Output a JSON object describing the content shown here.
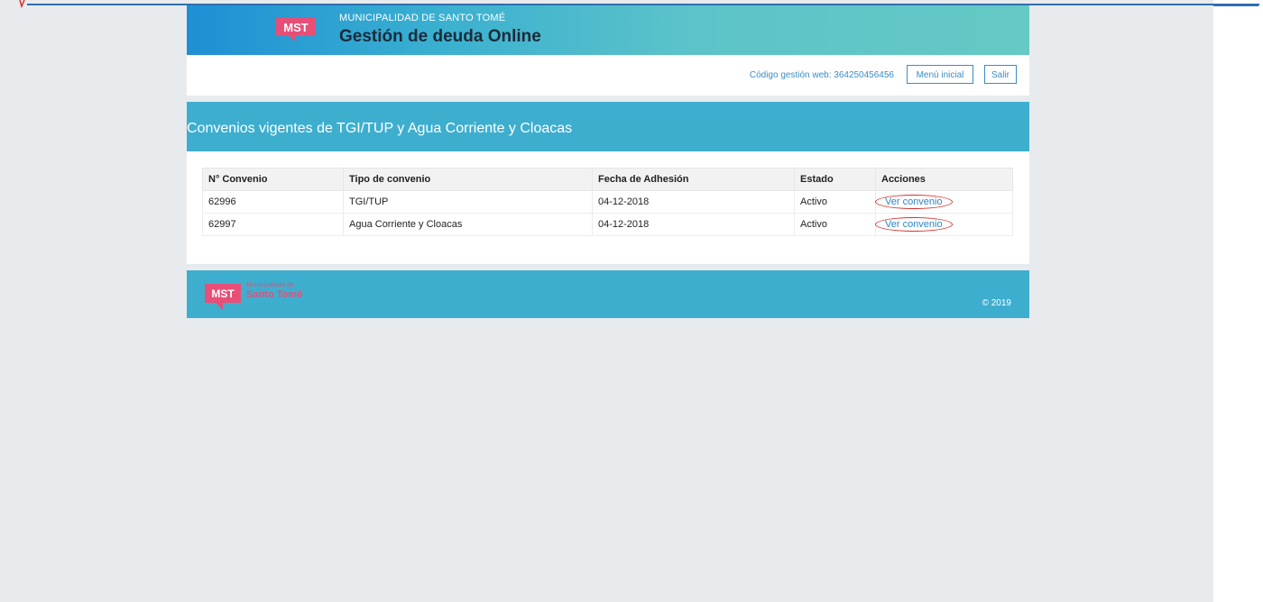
{
  "header": {
    "logo_text": "MST",
    "org_name": "MUNICIPALIDAD DE SANTO TOMÉ",
    "app_title": "Gestión de deuda Online"
  },
  "nav": {
    "code_label": "Código gestión web: 364250456456",
    "menu_button": "Menú inicial",
    "exit_button": "Salir"
  },
  "card": {
    "title": "Convenios vigentes de TGI/TUP y Agua Corriente y Cloacas"
  },
  "table": {
    "columns": [
      "N° Convenio",
      "Tipo de convenio",
      "Fecha de Adhesión",
      "Estado",
      "Acciones"
    ],
    "rows": [
      [
        "62996",
        "TGI/TUP",
        "04-12-2018",
        "Activo",
        "Ver convenio"
      ],
      [
        "62997",
        "Agua Corriente y Cloacas",
        "04-12-2018",
        "Activo",
        "Ver convenio"
      ]
    ]
  },
  "footer": {
    "logo_text": "MST",
    "org_small": "Municipalidad de",
    "org_big": "Santo Tomé",
    "copyright": "© 2019"
  },
  "colors": {
    "banner_start": "#1e8fd4",
    "banner_end": "#65c9c4",
    "accent": "#3eaecf",
    "link": "#2f86c3",
    "logo": "#e94e77",
    "annotation_circle": "#d9302a"
  }
}
